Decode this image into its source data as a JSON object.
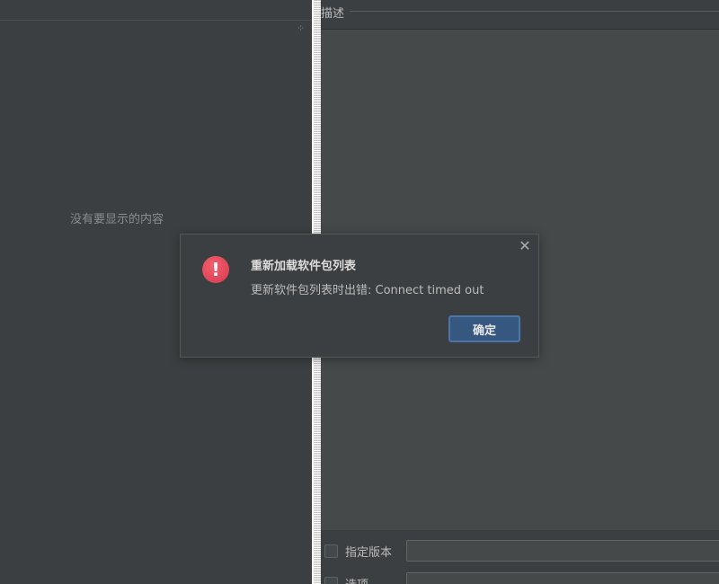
{
  "left_panel": {
    "empty_text": "没有要显示的内容",
    "spinner": "⁘"
  },
  "right_panel": {
    "description_title": "描述",
    "options": [
      {
        "label": "指定版本",
        "checked": false,
        "value": ""
      },
      {
        "label": "选项",
        "checked": false,
        "value": ""
      }
    ]
  },
  "dialog": {
    "icon": "error-exclamation-icon",
    "close_glyph": "✕",
    "title": "重新加载软件包列表",
    "message": "更新软件包列表时出错: Connect timed out",
    "ok_label": "确定"
  },
  "colors": {
    "background": "#3c3f41",
    "error": "#e0455a",
    "button": "#365880"
  }
}
